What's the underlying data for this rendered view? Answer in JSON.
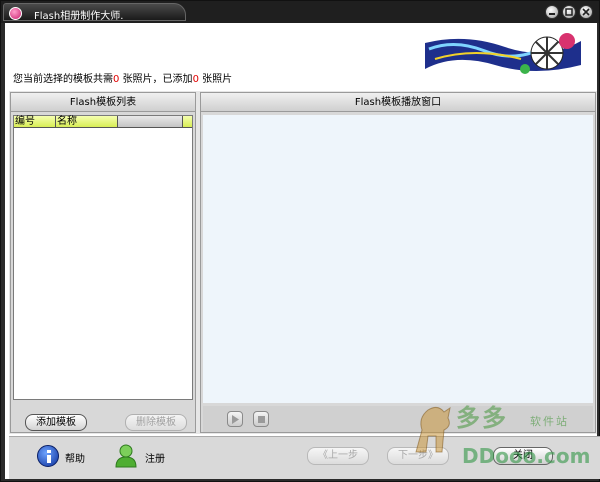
{
  "window": {
    "title": "Flash相册制作大师."
  },
  "info": {
    "prefix": "您当前选择的模板共需",
    "required_count": "0",
    "mid": "张照片，已添加",
    "added_count": "0",
    "suffix": "张照片"
  },
  "left_panel": {
    "title": "Flash模板列表",
    "columns": [
      "编号",
      "名称"
    ],
    "add_button": "添加模板",
    "delete_button": "删除模板"
  },
  "right_panel": {
    "title": "Flash模板播放窗口"
  },
  "bottom": {
    "help_label": "帮助",
    "register_label": "注册",
    "prev_button": "《上一步",
    "next_button": "下一步》",
    "close_button": "关闭"
  },
  "watermark": {
    "name": "多多",
    "tagline": "软件站",
    "url": "DDooo.com"
  },
  "colors": {
    "accent_count": "#e00000",
    "column_header": "#d8ee55",
    "player_bg": "#eef5fb"
  }
}
